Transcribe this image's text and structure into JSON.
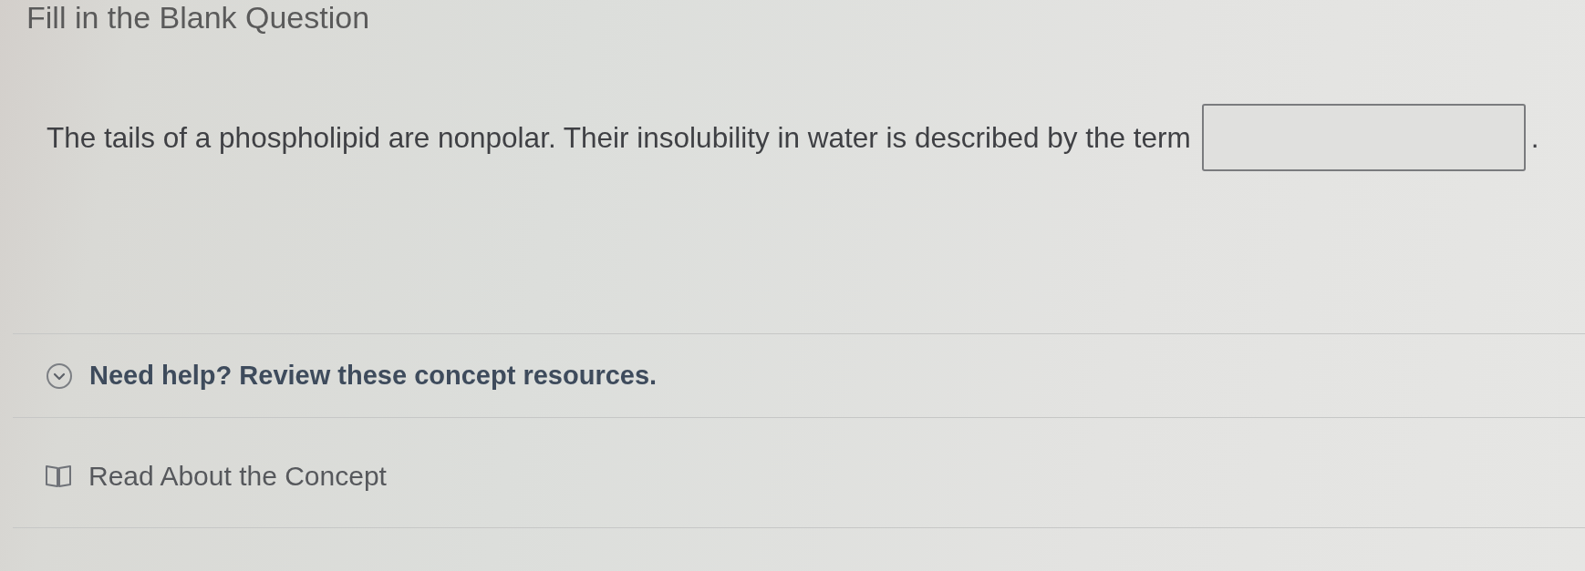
{
  "heading": "Fill in the Blank Question",
  "question": [
    {
      "kind": "text",
      "text": "The tails of a phospholipid are nonpolar. Their insolubility in water is described by the term"
    },
    {
      "kind": "blank"
    },
    {
      "kind": "text",
      "text": "."
    }
  ],
  "help": {
    "label": "Need help? Review these concept resources."
  },
  "resources": [
    {
      "kind": "reading",
      "label": "Read About the Concept"
    }
  ]
}
